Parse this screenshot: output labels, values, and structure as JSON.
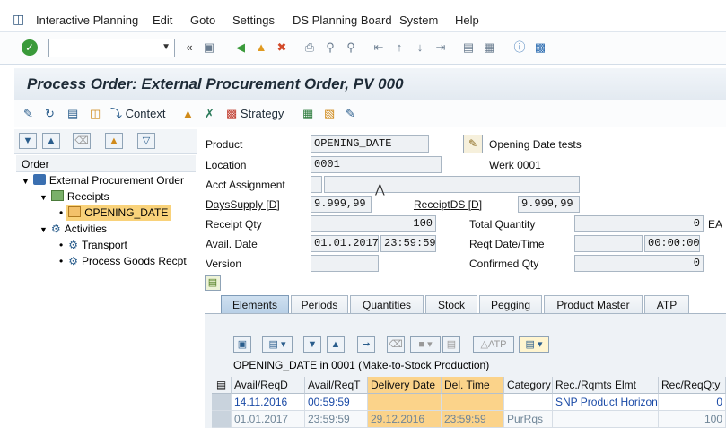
{
  "menubar": {
    "items": [
      "Interactive Planning",
      "Edit",
      "Goto",
      "Settings",
      "DS Planning Board",
      "System",
      "Help"
    ]
  },
  "toolbar": {
    "command_field_value": ""
  },
  "title": {
    "text": "Process Order: External Procurement Order, PV 000"
  },
  "app_toolbar": {
    "context_label": "Context",
    "strategy_label": "Strategy"
  },
  "tree": {
    "header": "Order",
    "nodes": [
      {
        "label": "External Procurement Order"
      },
      {
        "label": "Receipts"
      },
      {
        "label": "OPENING_DATE"
      },
      {
        "label": "Activities"
      },
      {
        "label": "Transport"
      },
      {
        "label": "Process Goods Recpt"
      }
    ]
  },
  "form": {
    "product_label": "Product",
    "product_value": "OPENING_DATE",
    "product_desc": "Opening Date tests",
    "location_label": "Location",
    "location_value": "0001",
    "location_desc": "Werk 0001",
    "acct_label": "Acct Assignment",
    "acct_value": "",
    "dayssupply_label": "DaysSupply [D]",
    "dayssupply_value": "9.999,99",
    "receiptds_label": "ReceiptDS [D]",
    "receiptds_value": "9.999,99",
    "receipt_qty_label": "Receipt Qty",
    "receipt_qty_value": "100",
    "total_qty_label": "Total Quantity",
    "total_qty_value": "0",
    "total_qty_unit": "EA",
    "avail_date_label": "Avail. Date",
    "avail_date_value": "01.01.2017",
    "avail_time_value": "23:59:59",
    "reqt_dt_label": "Reqt Date/Time",
    "reqt_date_value": "",
    "reqt_time_value": "00:00:00",
    "version_label": "Version",
    "version_value": "",
    "confirmed_qty_label": "Confirmed Qty",
    "confirmed_qty_value": "0"
  },
  "tabs": [
    "Elements",
    "Periods",
    "Quantities",
    "Stock",
    "Pegging",
    "Product Master",
    "ATP"
  ],
  "grid": {
    "atp_label": "ATP",
    "title": "OPENING_DATE in 0001 (Make-to-Stock Production)",
    "columns": [
      "Avail/ReqD",
      "Avail/ReqT",
      "Delivery Date",
      "Del. Time",
      "Category",
      "Rec./Rqmts Elmt",
      "Rec/ReqQty"
    ],
    "rows": [
      [
        "14.11.2016",
        "00:59:59",
        "",
        "",
        "",
        "SNP Product Horizon",
        "0"
      ],
      [
        "01.01.2017",
        "23:59:59",
        "29.12.2016",
        "23:59:59",
        "PurRqs",
        "",
        "100"
      ]
    ]
  }
}
